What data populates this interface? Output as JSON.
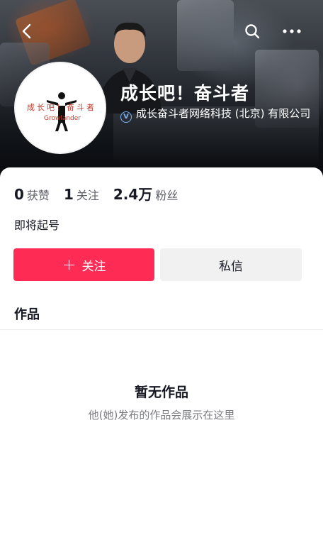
{
  "header": {
    "back_icon": "chevron-left-icon",
    "search_icon": "search-icon",
    "more_icon": "more-horizontal-icon"
  },
  "profile": {
    "name": "成长吧！奋斗者",
    "verification": "成长奋斗者网络科技 (北京) 有限公司",
    "verification_badge": "V",
    "avatar_text": "成长吧！奋斗者",
    "avatar_subtext": "Growlander",
    "bio": "即将起号"
  },
  "stats": [
    {
      "value": "0",
      "label": "获赞"
    },
    {
      "value": "1",
      "label": "关注"
    },
    {
      "value": "2.4万",
      "label": "粉丝"
    }
  ],
  "actions": {
    "follow_label": "关注",
    "message_label": "私信"
  },
  "tabs": {
    "works_label": "作品"
  },
  "empty_state": {
    "title": "暂无作品",
    "subtitle": "他(她)发布的作品会展示在这里"
  },
  "colors": {
    "accent": "#fe2c55",
    "verify_blue": "#7ab3f5",
    "secondary_button": "#f1f1f2"
  }
}
